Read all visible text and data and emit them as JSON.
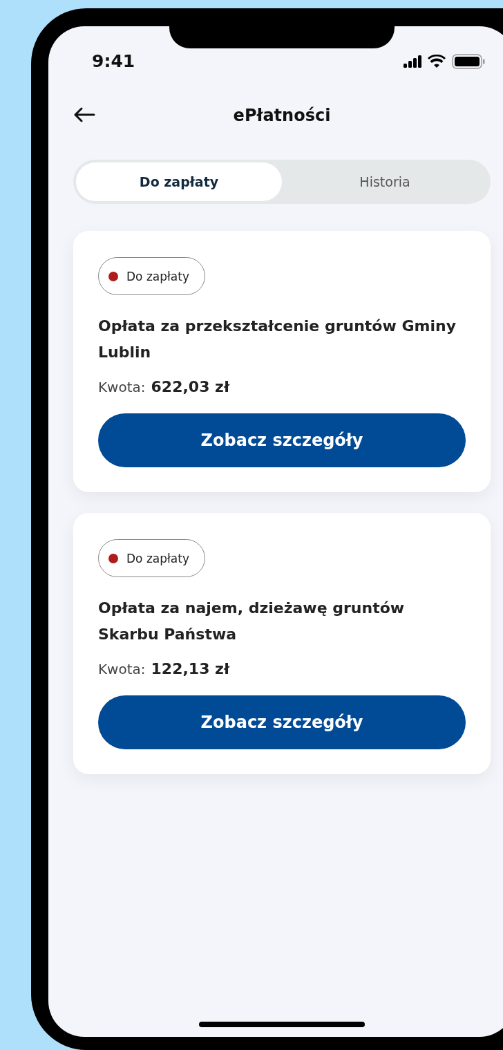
{
  "status_bar": {
    "time": "9:41"
  },
  "header": {
    "title": "ePłatności"
  },
  "tabs": [
    {
      "label": "Do zapłaty",
      "selected": true
    },
    {
      "label": "Historia",
      "selected": false
    }
  ],
  "payments": [
    {
      "status": {
        "label": "Do zapłaty",
        "color": "#b01c1c"
      },
      "title": "Opłata za przekształcenie gruntów Gminy Lublin",
      "amount_label": "Kwota:",
      "amount": "622,03 zł",
      "button": "Zobacz szczegóły"
    },
    {
      "status": {
        "label": "Do zapłaty",
        "color": "#b01c1c"
      },
      "title": "Opłata za najem, dzieżawę gruntów Skarbu Państwa",
      "amount_label": "Kwota:",
      "amount": "122,13 zł",
      "button": "Zobacz szczegóły"
    }
  ]
}
